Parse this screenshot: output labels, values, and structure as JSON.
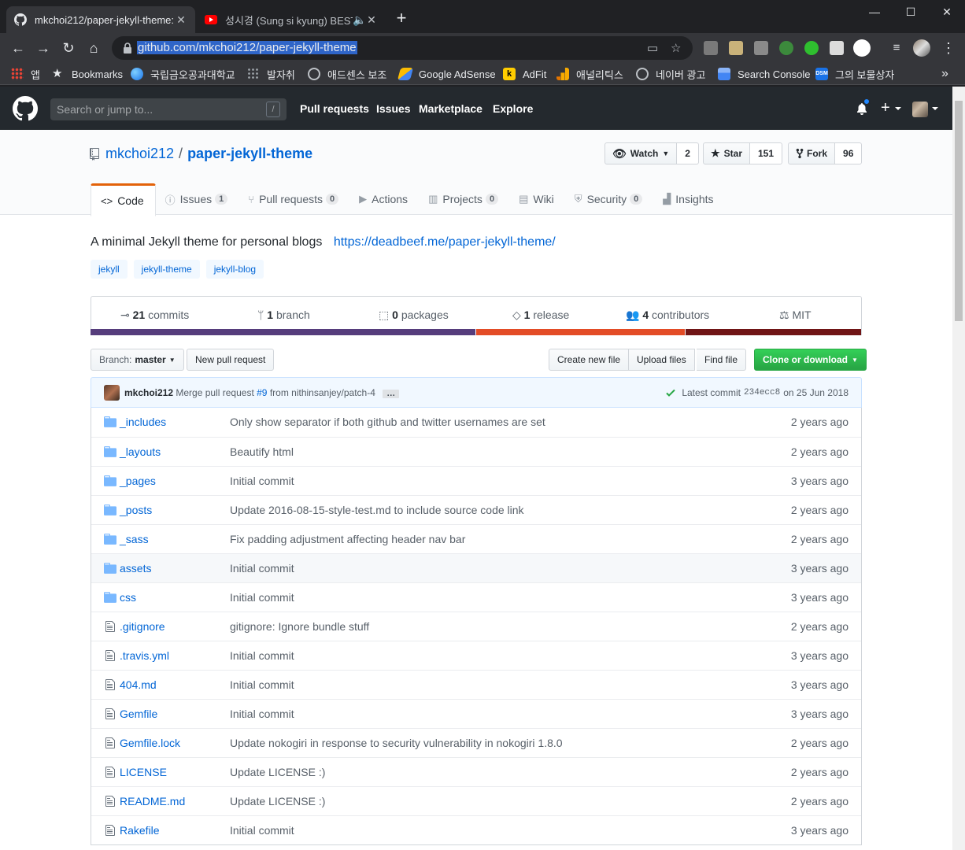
{
  "browser": {
    "tabs": [
      {
        "title": "mkchoi212/paper-jekyll-theme:",
        "active": true
      },
      {
        "title": "성시경 (Sung si kyung) BEST",
        "active": false
      }
    ],
    "new_tab": "+",
    "url": "github.com/mkchoi212/paper-jekyll-theme",
    "bookmarks": [
      {
        "label": "앱",
        "icon": "apps-grid-icon",
        "color": "#ea4335"
      },
      {
        "label": "Bookmarks",
        "icon": "star-icon",
        "color": "#e8eaed"
      },
      {
        "label": "국립금오공과대학교",
        "icon": "globe-icon",
        "color": "#1a73e8"
      },
      {
        "label": "발자취",
        "icon": "dots-icon",
        "color": "#9aa0a6"
      },
      {
        "label": "애드센스 보조",
        "icon": "globe-icon",
        "color": "#9aa0a6"
      },
      {
        "label": "Google AdSense",
        "icon": "adsense-icon",
        "color": "#fbbc04"
      },
      {
        "label": "AdFit",
        "icon": "kakao-icon",
        "color": "#ffcd00"
      },
      {
        "label": "애널리틱스",
        "icon": "analytics-icon",
        "color": "#f9ab00"
      },
      {
        "label": "네이버 광고",
        "icon": "globe-icon",
        "color": "#9aa0a6"
      },
      {
        "label": "Search Console",
        "icon": "search-console-icon",
        "color": "#4285f4"
      },
      {
        "label": "그의 보물상자",
        "icon": "dsm-icon",
        "color": "#1a73e8"
      }
    ],
    "bookmarks_more": "»"
  },
  "github": {
    "search_placeholder": "Search or jump to...",
    "search_shortcut": "/",
    "nav": [
      "Pull requests",
      "Issues",
      "Marketplace",
      "Explore"
    ],
    "accent": "#24292e"
  },
  "repo": {
    "owner": "mkchoi212",
    "separator": "/",
    "name": "paper-jekyll-theme",
    "watch": {
      "label": "Watch",
      "count": "2"
    },
    "star": {
      "label": "Star",
      "count": "151"
    },
    "fork": {
      "label": "Fork",
      "count": "96"
    },
    "tabs": [
      {
        "label": "Code",
        "icon": "code-icon",
        "count": null
      },
      {
        "label": "Issues",
        "icon": "issue-icon",
        "count": "1"
      },
      {
        "label": "Pull requests",
        "icon": "pull-request-icon",
        "count": "0"
      },
      {
        "label": "Actions",
        "icon": "play-icon",
        "count": null
      },
      {
        "label": "Projects",
        "icon": "project-icon",
        "count": "0"
      },
      {
        "label": "Wiki",
        "icon": "book-icon",
        "count": null
      },
      {
        "label": "Security",
        "icon": "shield-icon",
        "count": "0"
      },
      {
        "label": "Insights",
        "icon": "graph-icon",
        "count": null
      }
    ],
    "description": "A minimal Jekyll theme for personal blogs",
    "homepage": "https://deadbeef.me/paper-jekyll-theme/",
    "topics": [
      "jekyll",
      "jekyll-theme",
      "jekyll-blog"
    ],
    "summary": {
      "commits": {
        "num": "21",
        "label": "commits"
      },
      "branches": {
        "num": "1",
        "label": "branch"
      },
      "packages": {
        "num": "0",
        "label": "packages"
      },
      "releases": {
        "num": "1",
        "label": "release"
      },
      "contributors": {
        "num": "4",
        "label": "contributors"
      },
      "license": "MIT"
    },
    "languages": [
      {
        "color": "#563d7c",
        "share": 0.5
      },
      {
        "color": "#e34c26",
        "share": 0.272
      },
      {
        "color": "#701516",
        "share": 0.228
      }
    ],
    "branch_label": "Branch:",
    "branch": "master",
    "new_pr": "New pull request",
    "create_file": "Create new file",
    "upload_files": "Upload files",
    "find_file": "Find file",
    "clone": "Clone or download",
    "latest_commit": {
      "author": "mkchoi212",
      "msg_pre": "Merge pull request",
      "pr": "#9",
      "msg_post": "from nithinsanjey/patch-4",
      "ellipsis": "…",
      "label": "Latest commit",
      "sha": "234ecc8",
      "date": "on 25 Jun 2018"
    },
    "files": [
      {
        "name": "_includes",
        "type": "dir",
        "message": "Only show separator if both github and twitter usernames are set",
        "age": "2 years ago"
      },
      {
        "name": "_layouts",
        "type": "dir",
        "message": "Beautify html",
        "age": "2 years ago"
      },
      {
        "name": "_pages",
        "type": "dir",
        "message": "Initial commit",
        "age": "3 years ago"
      },
      {
        "name": "_posts",
        "type": "dir",
        "message": "Update 2016-08-15-style-test.md to include source code link",
        "age": "2 years ago"
      },
      {
        "name": "_sass",
        "type": "dir",
        "message": "Fix padding adjustment affecting header nav bar",
        "age": "2 years ago"
      },
      {
        "name": "assets",
        "type": "dir",
        "message": "Initial commit",
        "age": "3 years ago",
        "hover": true
      },
      {
        "name": "css",
        "type": "dir",
        "message": "Initial commit",
        "age": "3 years ago"
      },
      {
        "name": ".gitignore",
        "type": "file",
        "message": "gitignore: Ignore bundle stuff",
        "age": "2 years ago"
      },
      {
        "name": ".travis.yml",
        "type": "file",
        "message": "Initial commit",
        "age": "3 years ago"
      },
      {
        "name": "404.md",
        "type": "file",
        "message": "Initial commit",
        "age": "3 years ago"
      },
      {
        "name": "Gemfile",
        "type": "file",
        "message": "Initial commit",
        "age": "3 years ago"
      },
      {
        "name": "Gemfile.lock",
        "type": "file",
        "message": "Update nokogiri in response to security vulnerability in nokogiri 1.8.0",
        "age": "2 years ago"
      },
      {
        "name": "LICENSE",
        "type": "file",
        "message": "Update LICENSE :)",
        "age": "2 years ago"
      },
      {
        "name": "README.md",
        "type": "file",
        "message": "Update LICENSE :)",
        "age": "2 years ago"
      },
      {
        "name": "Rakefile",
        "type": "file",
        "message": "Initial commit",
        "age": "3 years ago"
      }
    ]
  }
}
